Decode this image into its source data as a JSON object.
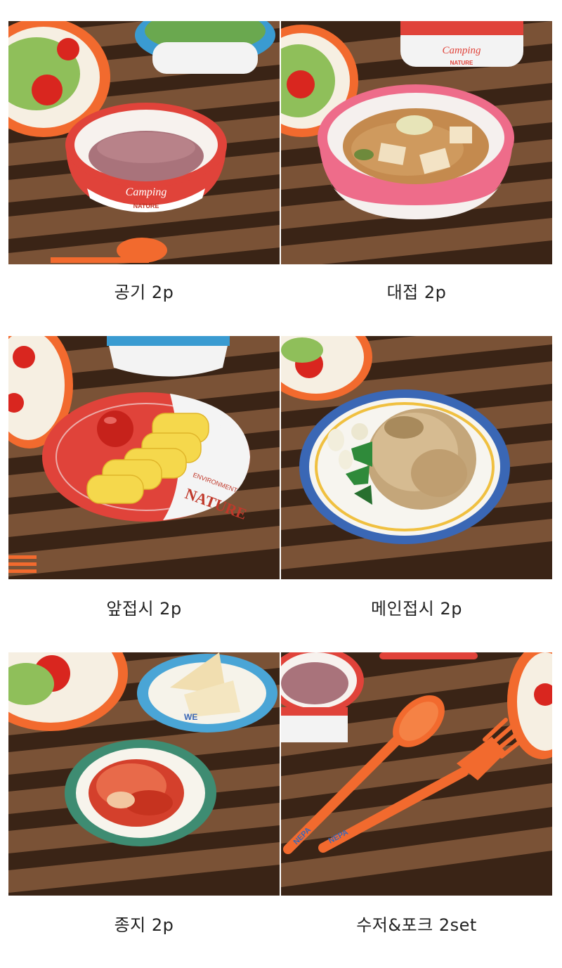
{
  "items": [
    {
      "caption": "공기 2p",
      "print_text": "Camping",
      "print_sub": "NATURE"
    },
    {
      "caption": "대접 2p",
      "print_text": "Camping",
      "print_sub": "NATURE"
    },
    {
      "caption": "앞접시 2p",
      "print_text": "NATURE",
      "print_sub": "ENVIRONMENT"
    },
    {
      "caption": "메인접시 2p"
    },
    {
      "caption": "종지 2p",
      "print_text": "WE"
    },
    {
      "caption": "수저&포크 2set",
      "print_text": "NEPA"
    }
  ],
  "colors": {
    "wood_dark": "#3a2416",
    "wood_slat": "#7a5236",
    "red_bowl": "#e0433a",
    "pink_bowl": "#ee6c8a",
    "blue_rim": "#3a67b5",
    "green_rim": "#3e8c72",
    "orange": "#f26a2e",
    "sky_blue": "#4aa5d6"
  }
}
